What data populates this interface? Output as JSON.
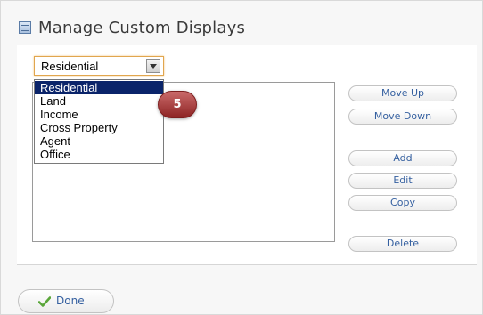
{
  "dialog": {
    "title": "Manage Custom Displays",
    "icon": "list-window-icon"
  },
  "display_select": {
    "value": "Residential",
    "options": [
      "Residential",
      "Land",
      "Income",
      "Cross Property",
      "Agent",
      "Office"
    ],
    "selected_index": 0
  },
  "callout": {
    "number": "5"
  },
  "buttons": {
    "move_up": "Move Up",
    "move_down": "Move Down",
    "add": "Add",
    "edit": "Edit",
    "copy": "Copy",
    "delete": "Delete",
    "done": "Done"
  },
  "colors": {
    "accent_text": "#3560a0",
    "selection": "#0a246a",
    "callout": "#a23434",
    "done_check": "#5aa63a"
  }
}
